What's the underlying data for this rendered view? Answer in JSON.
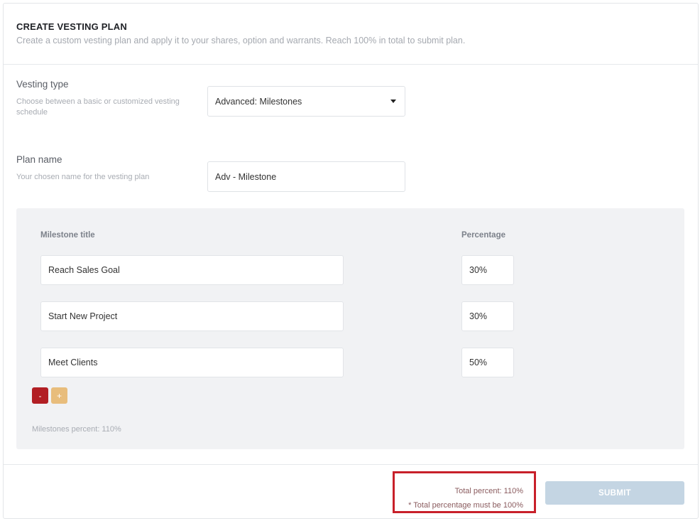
{
  "header": {
    "title": "CREATE VESTING PLAN",
    "subtitle": "Create a custom vesting plan and apply it to your shares, option and warrants. Reach 100% in total to submit plan."
  },
  "vesting_type": {
    "label": "Vesting type",
    "help": "Choose between a basic or customized vesting schedule",
    "selected": "Advanced: Milestones",
    "caret_icon": "caret-down-icon"
  },
  "plan_name": {
    "label": "Plan name",
    "help": "Your chosen name for the vesting plan",
    "value": "Adv - Milestone"
  },
  "milestones": {
    "col_title": "Milestone title",
    "col_percentage": "Percentage",
    "rows": [
      {
        "title": "Reach Sales Goal",
        "percentage": "30%"
      },
      {
        "title": "Start New Project",
        "percentage": "30%"
      },
      {
        "title": "Meet Clients",
        "percentage": "50%"
      }
    ],
    "remove_label": "-",
    "add_label": "+",
    "percent_summary": "Milestones percent: 110%"
  },
  "footer": {
    "total_percent": "Total percent: 110%",
    "error_message": "* Total percentage must be 100%",
    "submit_label": "SUBMIT"
  },
  "colors": {
    "remove_button": "#b21f24",
    "add_button": "#e8bd7c",
    "submit_disabled": "#c4d5e3",
    "error_border": "#c8202a",
    "panel_bg": "#f1f2f4"
  }
}
